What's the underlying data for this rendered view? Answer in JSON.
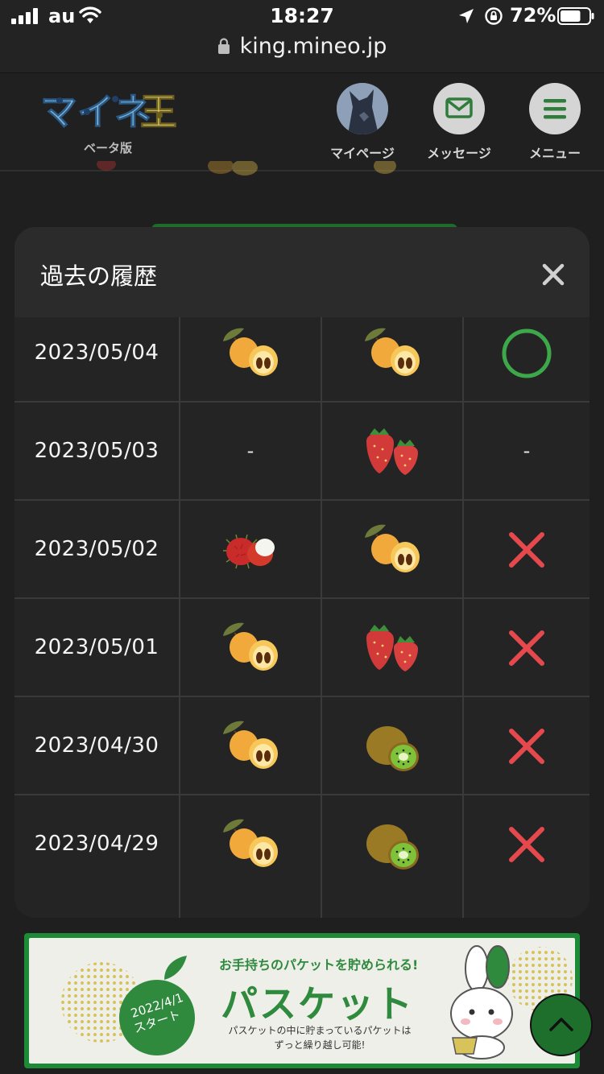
{
  "status_bar": {
    "carrier": "au",
    "time": "18:27",
    "battery_percent": "72%",
    "battery_level": 0.72
  },
  "browser": {
    "url": "king.mineo.jp"
  },
  "header": {
    "logo_text": "マイネ王",
    "logo_sub": "ベータ版",
    "nav": [
      {
        "label": "マイページ",
        "icon": "avatar"
      },
      {
        "label": "メッセージ",
        "icon": "envelope-icon"
      },
      {
        "label": "メニュー",
        "icon": "hamburger-icon"
      }
    ]
  },
  "modal": {
    "title": "過去の履歴",
    "close_icon": "close-icon",
    "rows": [
      {
        "date": "2023/05/04",
        "guess": "loquat",
        "answer": "loquat",
        "result": "correct"
      },
      {
        "date": "2023/05/03",
        "guess": "-",
        "answer": "strawberry",
        "result": "-"
      },
      {
        "date": "2023/05/02",
        "guess": "rambutan",
        "answer": "loquat",
        "result": "wrong"
      },
      {
        "date": "2023/05/01",
        "guess": "loquat",
        "answer": "strawberry",
        "result": "wrong"
      },
      {
        "date": "2023/04/30",
        "guess": "loquat",
        "answer": "kiwi",
        "result": "wrong"
      },
      {
        "date": "2023/04/29",
        "guess": "loquat",
        "answer": "kiwi",
        "result": "wrong"
      }
    ]
  },
  "banner": {
    "badge_line1": "2022/4/1",
    "badge_line2": "スタート",
    "subtitle": "お手持ちのパケットを貯められる!",
    "title": "パスケット",
    "desc_line1": "パスケットの中に貯まっているパケットは",
    "desc_line2": "ずっと繰り越し可能!"
  },
  "colors": {
    "accent_green": "#2f9e44",
    "wrong_red": "#e5484d",
    "modal_bg": "#2b2b2b"
  }
}
